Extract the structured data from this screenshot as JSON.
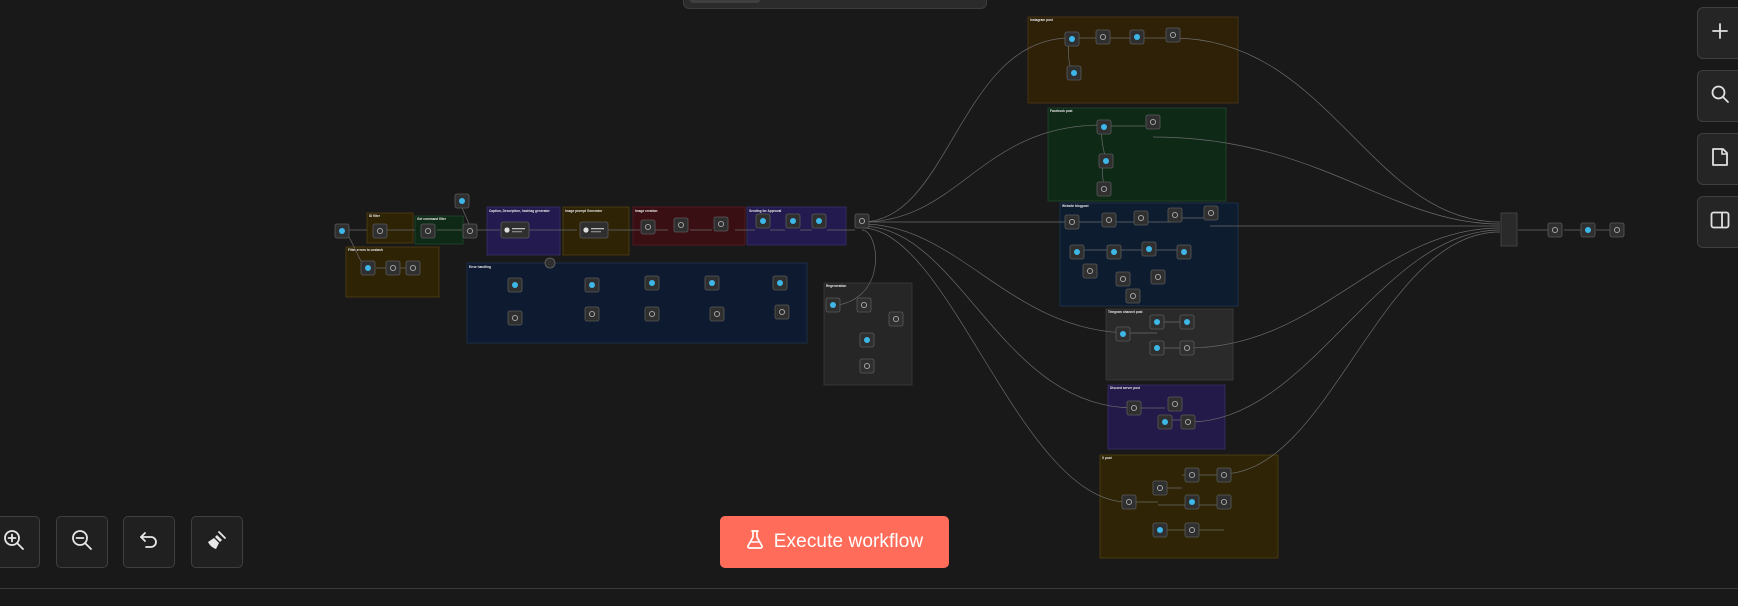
{
  "canvas": {
    "background": "#191919",
    "groups": [
      {
        "label": "Instagram post",
        "color": "#2e2107"
      },
      {
        "label": "Facebook post",
        "color": "#0e2a17"
      },
      {
        "label": "Website blogpost",
        "color": "#0e1c30"
      },
      {
        "label": "Telegram channel post",
        "color": "#2a2a2a"
      },
      {
        "label": "Discord server post",
        "color": "#241a4a"
      },
      {
        "label": "X post",
        "color": "#2f2506"
      },
      {
        "label": "Error handling",
        "color": "#0e1a2f"
      },
      {
        "label": "Caption, Description, hashtag generator",
        "color": "#231a4f"
      },
      {
        "label": "Image prompt Generator",
        "color": "#2f2306"
      },
      {
        "label": "Image creation",
        "color": "#3a0f14"
      },
      {
        "label": "Sending for Approval",
        "color": "#231a4f"
      },
      {
        "label": "Regeneration",
        "color": "#262626"
      },
      {
        "label": "ID filter",
        "color": "#2f2306"
      },
      {
        "label": "Get command filter",
        "color": "#0e2a17"
      },
      {
        "label": "Filter errors to unstash",
        "color": "#2f2306"
      }
    ]
  },
  "toolbar": {
    "execute_label": "Execute workflow",
    "accent": "#ff6d5a"
  },
  "zoom_controls": [
    {
      "name": "zoom-in-button",
      "icon": "zoom-in-icon"
    },
    {
      "name": "zoom-out-button",
      "icon": "zoom-out-icon"
    },
    {
      "name": "reset-zoom-button",
      "icon": "undo-icon"
    },
    {
      "name": "tidy-up-button",
      "icon": "broom-icon"
    }
  ],
  "side_controls": [
    {
      "name": "add-node-button",
      "icon": "plus-icon"
    },
    {
      "name": "search-button",
      "icon": "search-icon"
    },
    {
      "name": "sticky-note-button",
      "icon": "note-icon"
    },
    {
      "name": "toggle-panel-button",
      "icon": "panel-icon"
    }
  ]
}
